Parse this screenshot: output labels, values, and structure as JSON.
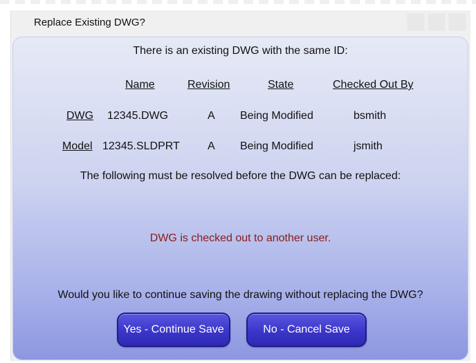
{
  "dialog": {
    "title": "Replace Existing DWG?",
    "intro": "There is an existing DWG with the same ID:",
    "headers": {
      "name": "Name",
      "revision": "Revision",
      "state": "State",
      "checked_out_by": "Checked Out By"
    },
    "rows": [
      {
        "label": "DWG",
        "name": "12345.DWG",
        "revision": "A",
        "state": "Being Modified",
        "checked_out_by": "bsmith"
      },
      {
        "label": "Model",
        "name": "12345.SLDPRT",
        "revision": "A",
        "state": "Being Modified",
        "checked_out_by": "jsmith"
      }
    ],
    "resolve_text": "The following must be resolved before the DWG can be replaced:",
    "error_text": "DWG is checked out to another user.",
    "question": "Would you like to continue saving the drawing without replacing the DWG?",
    "buttons": {
      "yes": "Yes - Continue Save",
      "no": "No - Cancel Save"
    }
  },
  "colors": {
    "error": "#8b1a1a",
    "button": "#3b36c9",
    "panel_top": "#e6eaf6",
    "panel_bottom": "#8c97e0"
  }
}
